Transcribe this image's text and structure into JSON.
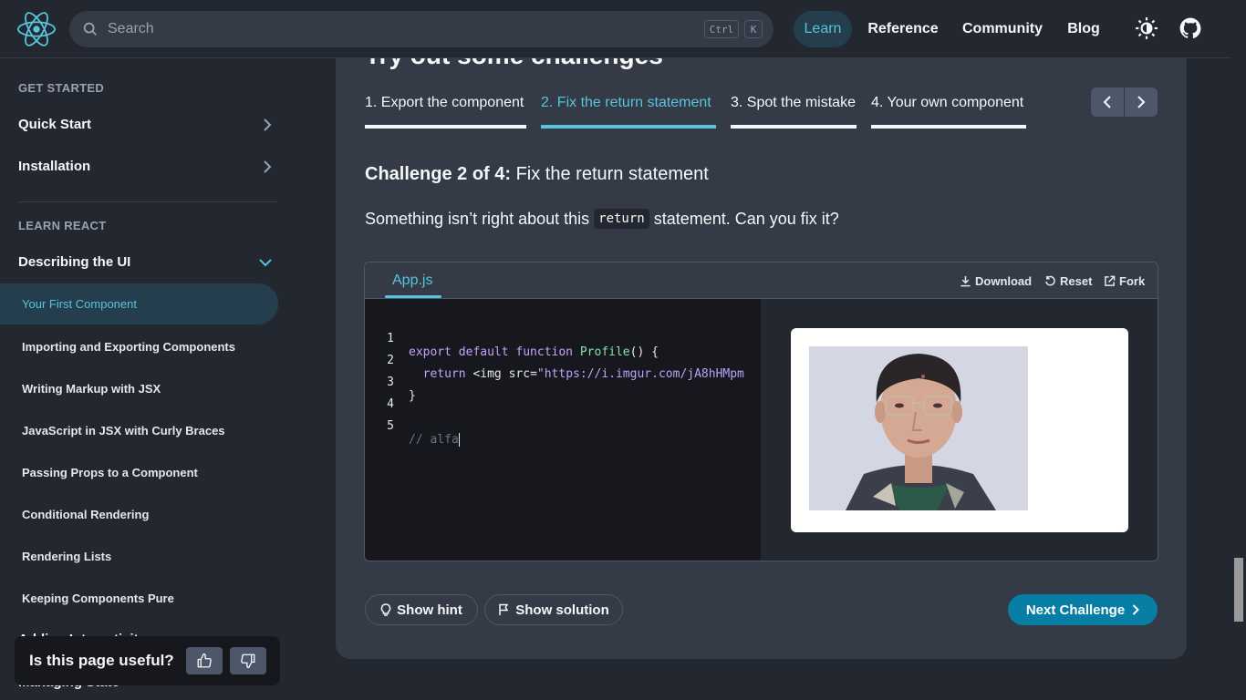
{
  "colors": {
    "accent": "#58c4dc",
    "background": "#23272f",
    "panel": "#343a46",
    "next_button": "#087ea4"
  },
  "header": {
    "search_placeholder": "Search",
    "shortcut_ctrl": "Ctrl",
    "shortcut_k": "K",
    "nav": {
      "learn": "Learn",
      "reference": "Reference",
      "community": "Community",
      "blog": "Blog"
    }
  },
  "sidebar": {
    "get_started": "GET STARTED",
    "quick_start": "Quick Start",
    "installation": "Installation",
    "learn_react": "LEARN REACT",
    "describing_ui": "Describing the UI",
    "active": "Your First Component",
    "items": [
      "Importing and Exporting Components",
      "Writing Markup with JSX",
      "JavaScript in JSX with Curly Braces",
      "Passing Props to a Component",
      "Conditional Rendering",
      "Rendering Lists",
      "Keeping Components Pure"
    ],
    "partial_1": "Adding Interactivity",
    "partial_2": "Managing State"
  },
  "feedback": {
    "question": "Is this page useful?"
  },
  "main": {
    "heading": "Try out some challenges",
    "tabs": [
      "1. Export the component",
      "2. Fix the return statement",
      "3. Spot the mistake",
      "4. Your own component"
    ],
    "challenge_prefix": "Challenge 2 of 4:",
    "challenge_title": "Fix the return statement",
    "desc_before": "Something isn’t right about this",
    "desc_code": "return",
    "desc_after": "statement. Can you fix it?"
  },
  "sandbox": {
    "file": "App.js",
    "download": "Download",
    "reset": "Reset",
    "fork": "Fork",
    "line_numbers": [
      "1",
      "2",
      "3",
      "4",
      "5"
    ],
    "code": {
      "l1_kw": "export default function ",
      "l1_fn": "Profile",
      "l1_rest": "() {",
      "l2_kw": "  return ",
      "l2_tag": "<img src=",
      "l2_str": "\"https://i.imgur.com/jA8hHMpm",
      "l3": "}",
      "l5": "// alfa"
    }
  },
  "buttons": {
    "hint": "Show hint",
    "solution": "Show solution",
    "next": "Next Challenge"
  }
}
